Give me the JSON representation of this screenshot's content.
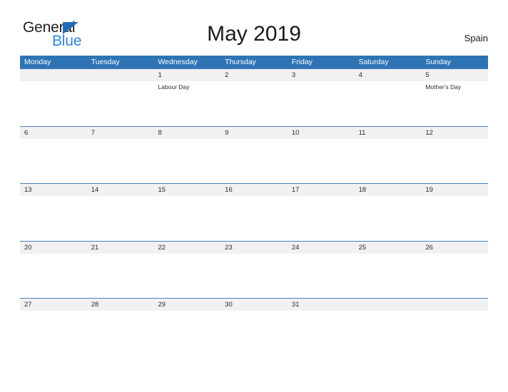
{
  "brand": {
    "name_part1": "General",
    "name_part2": "Blue",
    "flag_icon": "triangle-flag-icon",
    "color_dark": "#231f20",
    "color_blue": "#2e86d4",
    "flag_color": "#1f6db5"
  },
  "header": {
    "title": "May 2019",
    "country": "Spain"
  },
  "colors": {
    "header_bar": "#2e74b5",
    "row_band": "#f1f1f1",
    "row_rule": "#4a7ebb",
    "page_background": "#ffffff"
  },
  "calendar": {
    "month": "May",
    "year": "2019",
    "first_day_of_week": "Monday",
    "weekdays": [
      "Monday",
      "Tuesday",
      "Wednesday",
      "Thursday",
      "Friday",
      "Saturday",
      "Sunday"
    ],
    "weeks": [
      [
        {
          "date": "",
          "event": ""
        },
        {
          "date": "",
          "event": ""
        },
        {
          "date": "1",
          "event": "Labour Day"
        },
        {
          "date": "2",
          "event": ""
        },
        {
          "date": "3",
          "event": ""
        },
        {
          "date": "4",
          "event": ""
        },
        {
          "date": "5",
          "event": "Mother's Day"
        }
      ],
      [
        {
          "date": "6",
          "event": ""
        },
        {
          "date": "7",
          "event": ""
        },
        {
          "date": "8",
          "event": ""
        },
        {
          "date": "9",
          "event": ""
        },
        {
          "date": "10",
          "event": ""
        },
        {
          "date": "11",
          "event": ""
        },
        {
          "date": "12",
          "event": ""
        }
      ],
      [
        {
          "date": "13",
          "event": ""
        },
        {
          "date": "14",
          "event": ""
        },
        {
          "date": "15",
          "event": ""
        },
        {
          "date": "16",
          "event": ""
        },
        {
          "date": "17",
          "event": ""
        },
        {
          "date": "18",
          "event": ""
        },
        {
          "date": "19",
          "event": ""
        }
      ],
      [
        {
          "date": "20",
          "event": ""
        },
        {
          "date": "21",
          "event": ""
        },
        {
          "date": "22",
          "event": ""
        },
        {
          "date": "23",
          "event": ""
        },
        {
          "date": "24",
          "event": ""
        },
        {
          "date": "25",
          "event": ""
        },
        {
          "date": "26",
          "event": ""
        }
      ],
      [
        {
          "date": "27",
          "event": ""
        },
        {
          "date": "28",
          "event": ""
        },
        {
          "date": "29",
          "event": ""
        },
        {
          "date": "30",
          "event": ""
        },
        {
          "date": "31",
          "event": ""
        },
        {
          "date": "",
          "event": ""
        },
        {
          "date": "",
          "event": ""
        }
      ]
    ]
  }
}
